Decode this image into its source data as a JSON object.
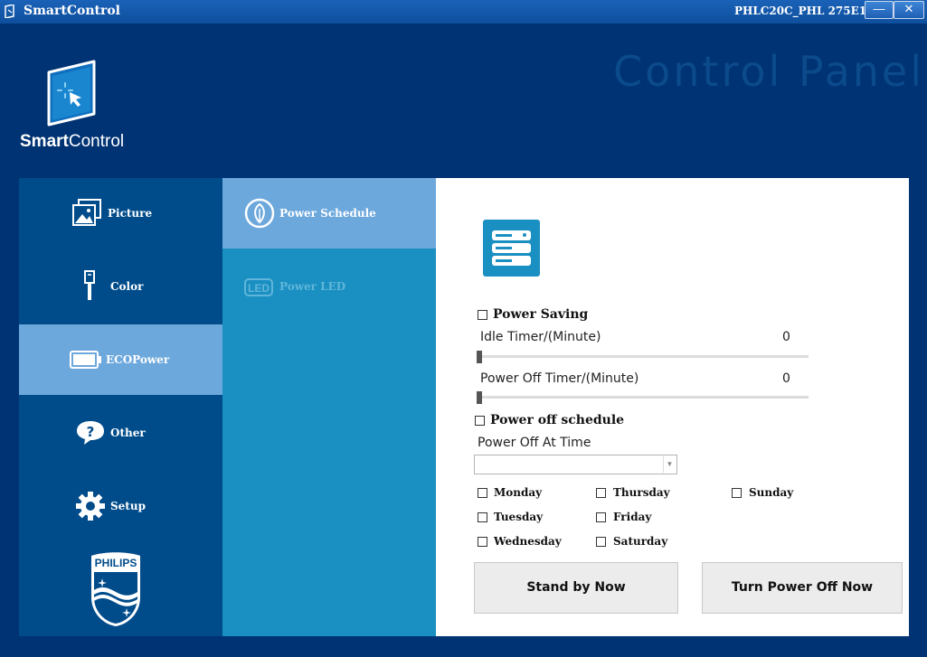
{
  "window": {
    "title": "SmartControl",
    "model": "PHLC20C_PHL 275E1",
    "minimize_label": "—",
    "close_label": "✕"
  },
  "header": {
    "panel_title": "Control Panel",
    "brand_bold": "Smart",
    "brand_rest": "Control",
    "philips_label": "PHILIPS"
  },
  "leftnav": {
    "items": [
      {
        "label": "Picture",
        "icon": "picture-icon"
      },
      {
        "label": "Color",
        "icon": "color-icon"
      },
      {
        "label": "ECOPower",
        "icon": "battery-icon"
      },
      {
        "label": "Other",
        "icon": "help-bubble-icon"
      },
      {
        "label": "Setup",
        "icon": "gear-icon"
      }
    ],
    "selected": "ECOPower"
  },
  "subnav": {
    "items": [
      {
        "label": "Power Schedule",
        "icon": "leaf-icon"
      },
      {
        "label": "Power LED",
        "icon": "led-icon",
        "badge": "LED"
      }
    ],
    "selected": "Power Schedule"
  },
  "content": {
    "power_saving": {
      "label": "Power Saving",
      "checked": false,
      "idle_timer_label": "Idle Timer/(Minute)",
      "idle_timer_value": "0",
      "power_off_timer_label": "Power Off Timer/(Minute)",
      "power_off_timer_value": "0"
    },
    "power_off_schedule": {
      "label": "Power off schedule",
      "checked": false,
      "time_label": "Power Off At Time",
      "time_value": "",
      "days": [
        "Monday",
        "Thursday",
        "Sunday",
        "Tuesday",
        "Friday",
        "Wednesday",
        "Saturday"
      ]
    },
    "buttons": {
      "standby": "Stand by Now",
      "power_off": "Turn Power Off Now"
    }
  },
  "colors": {
    "background": "#003373",
    "left_nav": "#004c8b",
    "sub_nav": "#1a8fc1",
    "selected": "#6da8dc",
    "icon_tile": "#1a8fc1"
  }
}
